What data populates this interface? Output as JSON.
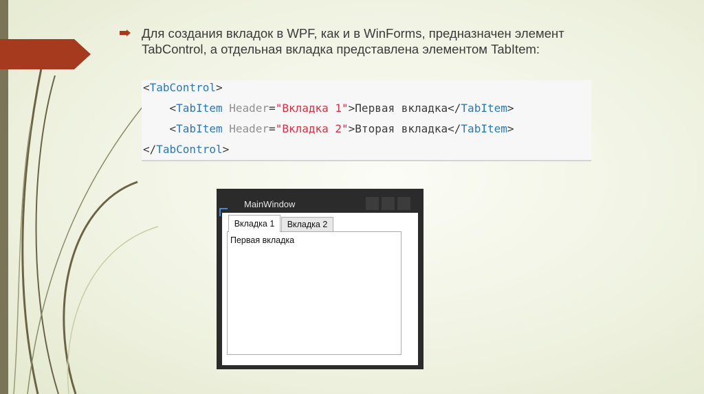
{
  "slide": {
    "bullet_text": "Для создания вкладок в WPF, как и в WinForms, предназначен элемент TabControl, а отдельная вкладка представлена элементом TabItem:",
    "colors": {
      "accent_red": "#a63a1f",
      "side_bar": "#7b7557",
      "background": "#f0f3e2"
    },
    "bullet_icon": "arrow-bullet-icon"
  },
  "code": {
    "line1": {
      "open": "<",
      "tag": "TabControl",
      "close": ">"
    },
    "line2": {
      "indent": "    ",
      "open": "<",
      "tag": "TabItem",
      "attr": " Header",
      "eq": "=",
      "str": "\"Вкладка 1\"",
      "gt": ">",
      "content": "Первая вкладка",
      "end_open": "</",
      "end_tag": "TabItem",
      "end_close": ">"
    },
    "line3": {
      "indent": "    ",
      "open": "<",
      "tag": "TabItem",
      "attr": " Header",
      "eq": "=",
      "str": "\"Вкладка 2\"",
      "gt": ">",
      "content": "Вторая вкладка",
      "end_open": "</",
      "end_tag": "TabItem",
      "end_close": ">"
    },
    "line4": {
      "open": "</",
      "tag": "TabControl",
      "close": ">"
    }
  },
  "window": {
    "title": "MainWindow",
    "tabs": [
      {
        "label": "Вкладка 1",
        "selected": true
      },
      {
        "label": "Вкладка 2",
        "selected": false
      }
    ],
    "panel_text": "Первая вкладка"
  }
}
